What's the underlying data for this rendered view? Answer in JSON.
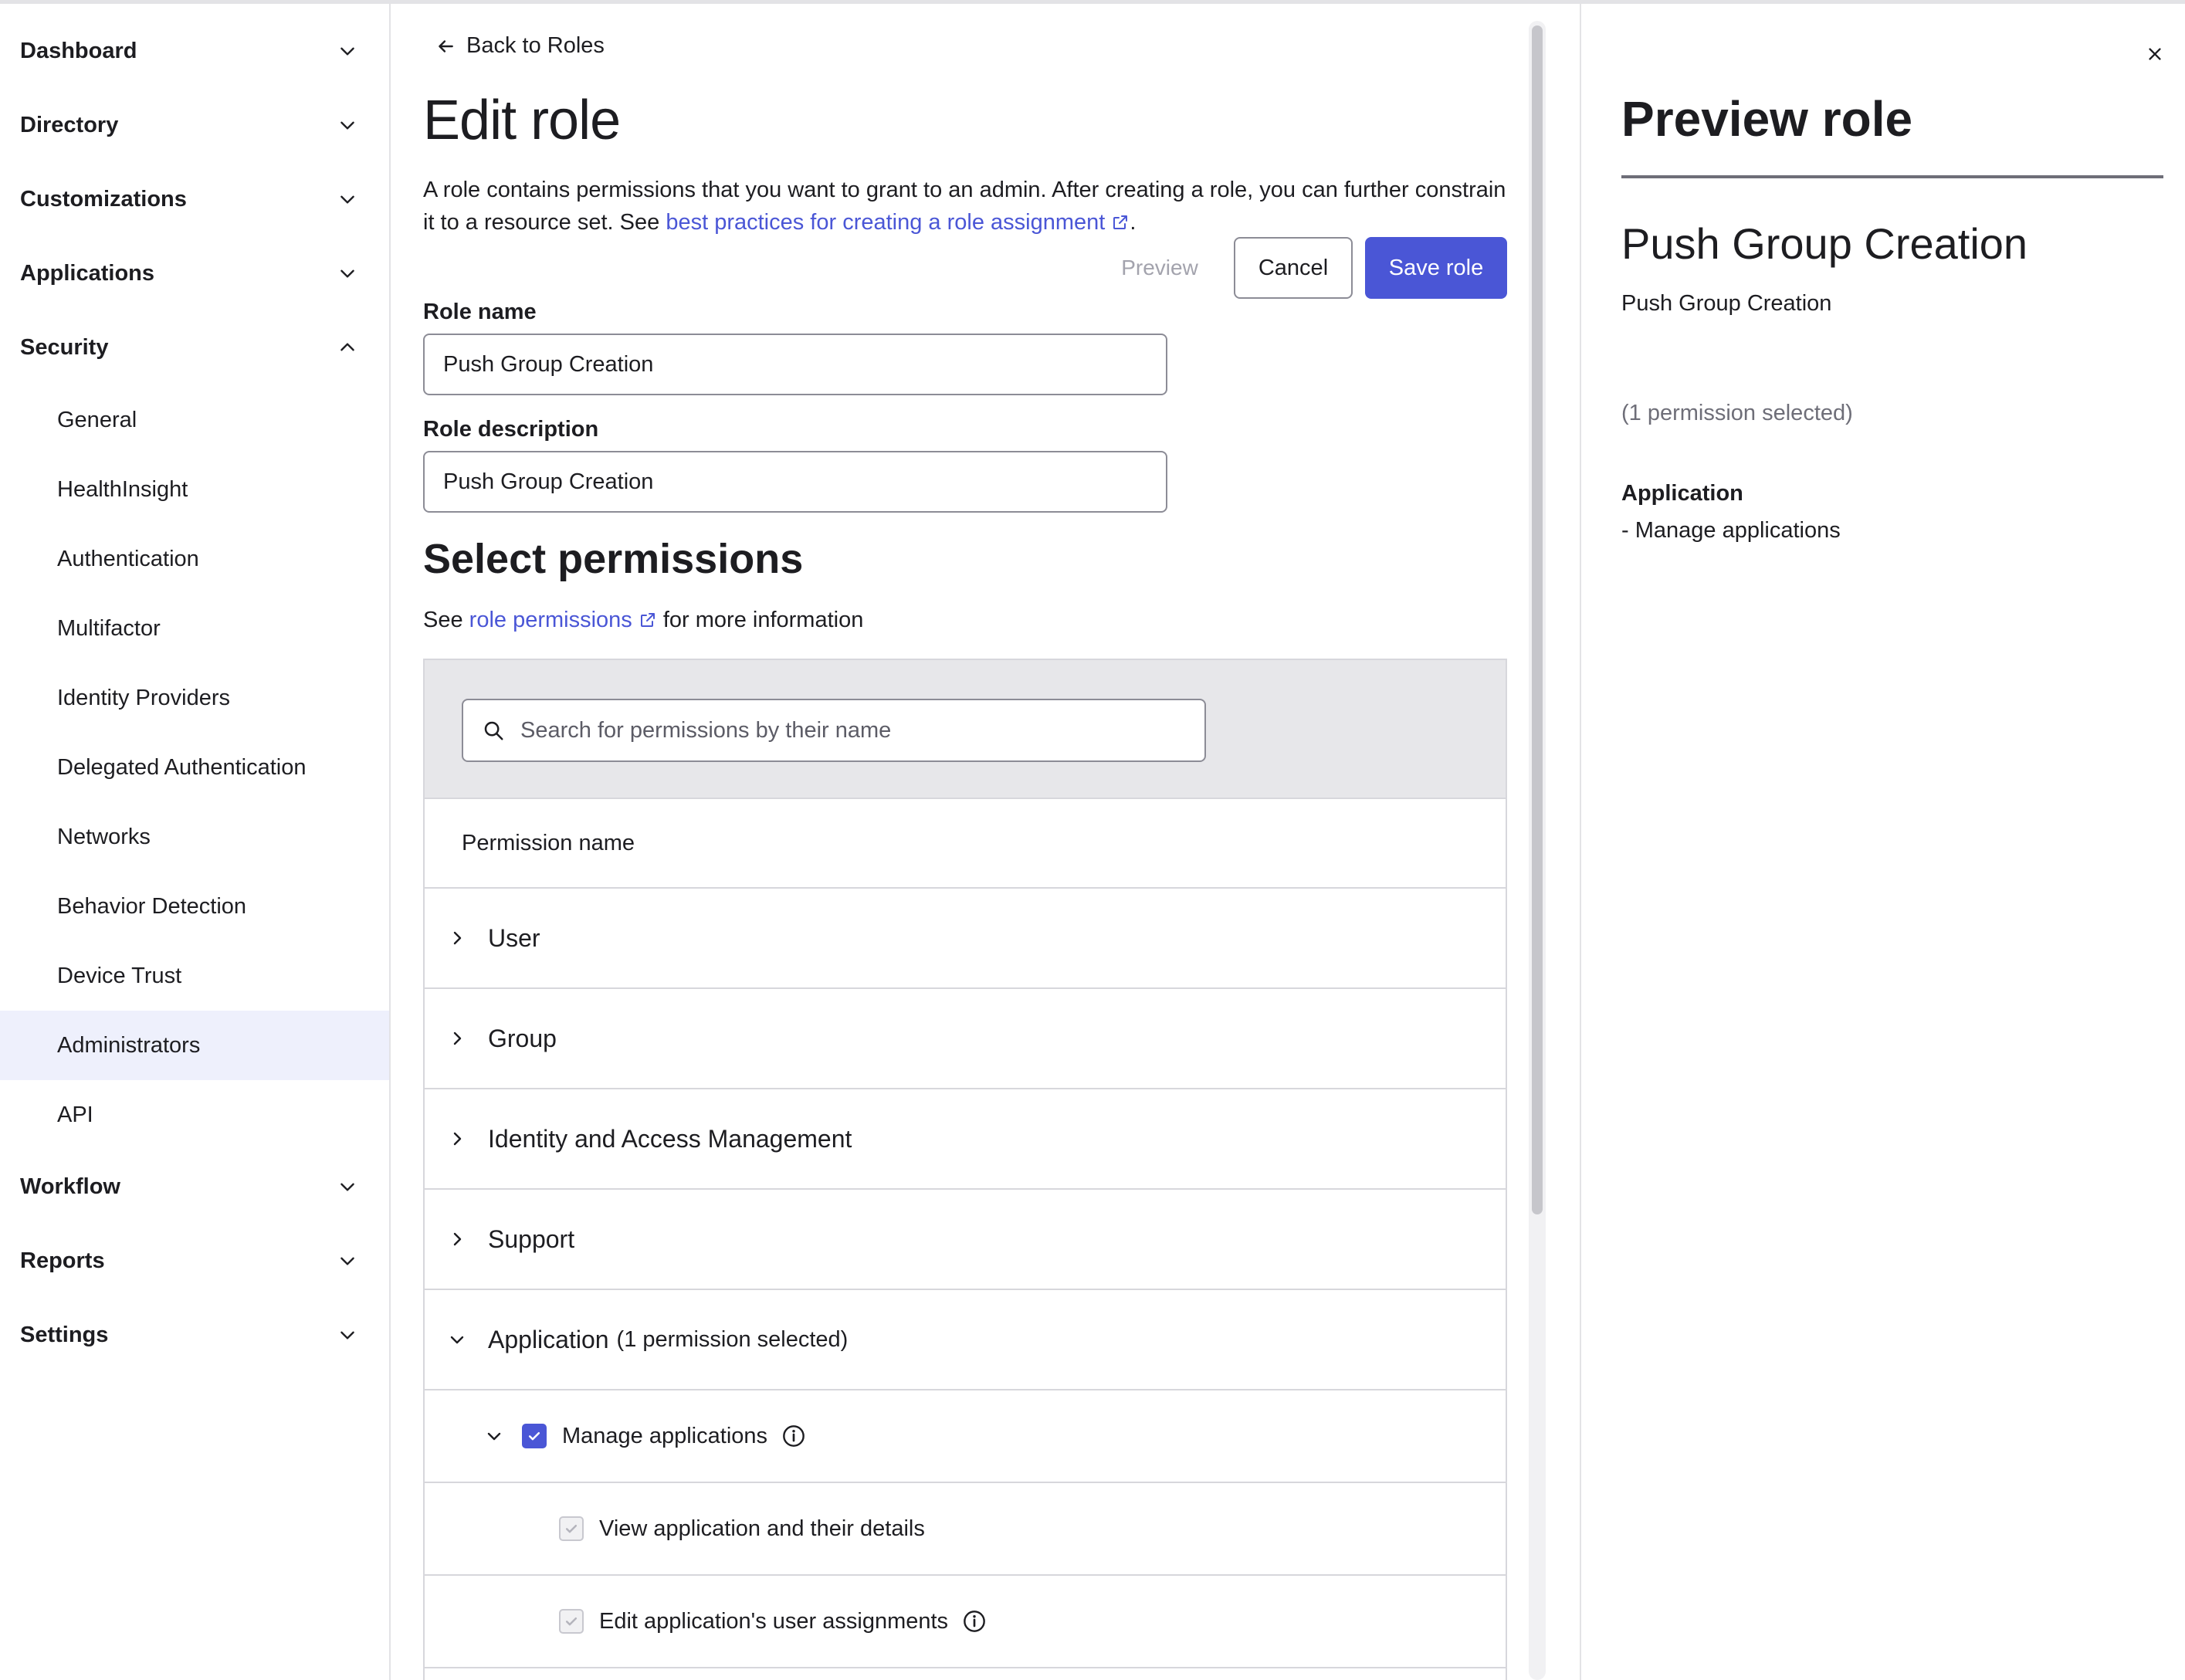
{
  "sidebar": {
    "sections": [
      {
        "label": "Dashboard",
        "expanded": false
      },
      {
        "label": "Directory",
        "expanded": false
      },
      {
        "label": "Customizations",
        "expanded": false
      },
      {
        "label": "Applications",
        "expanded": false
      },
      {
        "label": "Security",
        "expanded": true
      },
      {
        "label": "Workflow",
        "expanded": false
      },
      {
        "label": "Reports",
        "expanded": false
      },
      {
        "label": "Settings",
        "expanded": false
      }
    ],
    "security_items": [
      {
        "label": "General"
      },
      {
        "label": "HealthInsight"
      },
      {
        "label": "Authentication"
      },
      {
        "label": "Multifactor"
      },
      {
        "label": "Identity Providers"
      },
      {
        "label": "Delegated Authentication"
      },
      {
        "label": "Networks"
      },
      {
        "label": "Behavior Detection"
      },
      {
        "label": "Device Trust"
      },
      {
        "label": "Administrators",
        "active": true
      },
      {
        "label": "API"
      }
    ]
  },
  "main": {
    "back_label": "Back to Roles",
    "title": "Edit role",
    "intro_text": "A role contains permissions that you want to grant to an admin. After creating a role, you can further constrain it to a resource set. See ",
    "intro_link": "best practices for creating a role assignment",
    "intro_end": ".",
    "buttons": {
      "preview": "Preview",
      "cancel": "Cancel",
      "save": "Save role"
    },
    "role_name_label": "Role name",
    "role_name_value": "Push Group Creation",
    "role_desc_label": "Role description",
    "role_desc_value": "Push Group Creation",
    "permissions_title": "Select permissions",
    "see_prefix": "See ",
    "see_link": "role permissions",
    "see_suffix": " for more information",
    "search_placeholder": "Search for permissions by their name",
    "table_header": "Permission name",
    "groups": [
      {
        "label": "User",
        "expanded": false
      },
      {
        "label": "Group",
        "expanded": false
      },
      {
        "label": "Identity and Access Management",
        "expanded": false
      },
      {
        "label": "Support",
        "expanded": false
      },
      {
        "label": "Application",
        "count_text": "(1 permission selected)",
        "expanded": true
      }
    ],
    "app_permissions": [
      {
        "label": "Manage applications",
        "checked": true,
        "has_info": true
      },
      {
        "label": "View application and their details",
        "checked": true,
        "disabled": true,
        "has_info": false
      },
      {
        "label": "Edit application's user assignments",
        "checked": true,
        "disabled": true,
        "has_info": true
      }
    ]
  },
  "preview": {
    "title": "Preview role",
    "role_name": "Push Group Creation",
    "role_description": "Push Group Creation",
    "count_text": "(1 permission selected)",
    "group": "Application",
    "permission": "- Manage applications"
  },
  "colors": {
    "accent": "#4a56d6",
    "active_nav_bg": "#eef0fc",
    "border": "#d7d7dc",
    "search_band": "#e7e7ea"
  }
}
